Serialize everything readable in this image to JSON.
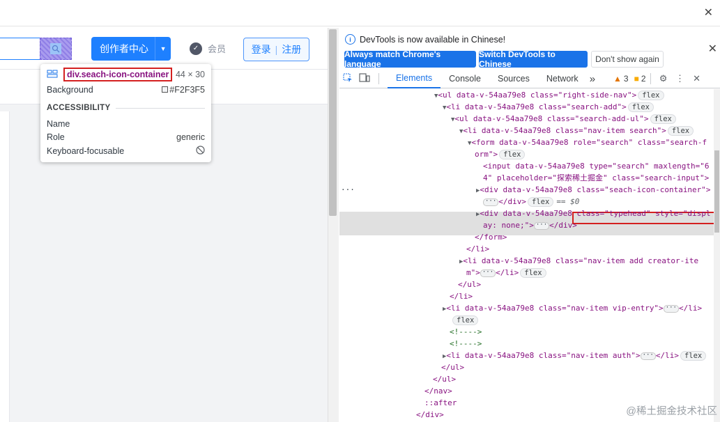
{
  "window": {
    "close_glyph": "✕"
  },
  "page": {
    "creator_button": {
      "label": "创作者中心",
      "dropdown": "▼"
    },
    "vip": {
      "icon": "vip-shield-icon",
      "label": "会员"
    },
    "login": {
      "login_label": "登录",
      "divider": "|",
      "register_label": "注册"
    }
  },
  "inspect_tooltip": {
    "selector": "div.seach-icon-container",
    "size": "44 × 30",
    "background_label": "Background",
    "background_value": "#F2F3F5",
    "accessibility_heading": "ACCESSIBILITY",
    "name_label": "Name",
    "role_label": "Role",
    "role_value": "generic",
    "focusable_label": "Keyboard-focusable"
  },
  "devtools": {
    "info_message": "DevTools is now available in Chinese!",
    "match_language_button": "Always match Chrome's language",
    "switch_button": "Switch DevTools to Chinese",
    "dont_show_button": "Don't show again",
    "close_glyph": "✕",
    "tabs": [
      "Elements",
      "Console",
      "Sources",
      "Network"
    ],
    "more_tabs": "»",
    "warnings_count": "3",
    "messages_count": "2",
    "dom_lines": [
      "<ul data-v-54aa79e8 class=\"right-side-nav\">",
      "<li data-v-54aa79e8 class=\"search-add\">",
      "<ul data-v-54aa79e8 class=\"search-add-ul\">",
      "<li data-v-54aa79e8 class=\"nav-item search\">",
      "<form data-v-54aa79e8 role=\"search\" class=\"search-f",
      "orm\">",
      "<input data-v-54aa79e8 type=\"search\" maxlength=\"6",
      "4\" placeholder=\"探索稀土掘金\" class=\"search-input\">",
      "<div data-v-54aa79e8 class=\"seach-icon-container\">",
      "</div>",
      "== $0",
      "<div data-v-54aa79e8 class=\"typehead\" style=\"displ",
      "ay: none;\">",
      "</div>",
      "</form>",
      "</li>",
      "<li data-v-54aa79e8 class=\"nav-item add creator-ite",
      "m\">",
      "</li>",
      "</ul>",
      "</li>",
      "<li data-v-54aa79e8 class=\"nav-item vip-entry\">",
      "</li>",
      "<!---->",
      "<!---->",
      "<li data-v-54aa79e8 class=\"nav-item auth\">",
      "</li>",
      "</ul>",
      "</nav>",
      "::after",
      "</div>"
    ],
    "flex_pill": "flex",
    "ellipsis_marker": "···"
  },
  "watermark": "@稀土掘金技术社区",
  "colors": {
    "accent": "#1e80ff",
    "devtools_blue": "#1a73e8",
    "highlight_red": "#d42020"
  }
}
